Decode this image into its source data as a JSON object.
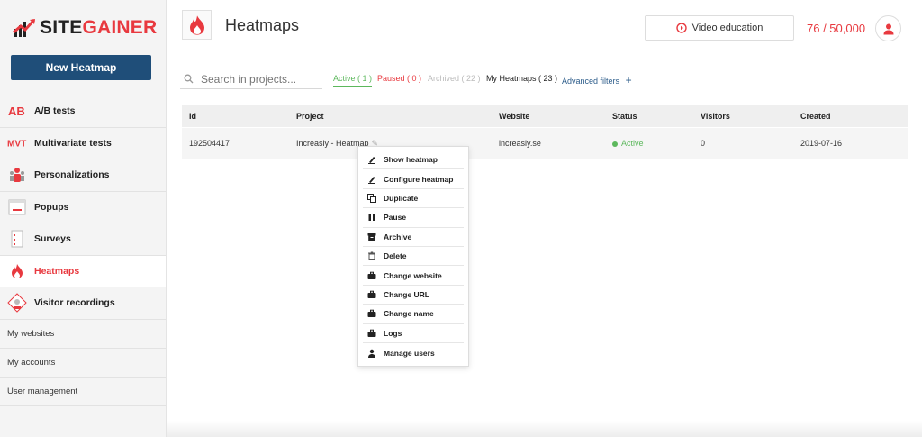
{
  "brand": {
    "part1": "SITE",
    "part2": "GAINER"
  },
  "sidebar": {
    "new_button": "New Heatmap",
    "items": [
      {
        "label": "A/B tests",
        "icon": "ab-icon"
      },
      {
        "label": "Multivariate tests",
        "icon": "mvt-icon"
      },
      {
        "label": "Personalizations",
        "icon": "people-icon"
      },
      {
        "label": "Popups",
        "icon": "popup-icon"
      },
      {
        "label": "Surveys",
        "icon": "survey-icon"
      },
      {
        "label": "Heatmaps",
        "icon": "flame-icon",
        "active": true
      },
      {
        "label": "Visitor recordings",
        "icon": "recording-icon"
      }
    ],
    "links": [
      "My websites",
      "My accounts",
      "User management"
    ]
  },
  "header": {
    "title": "Heatmaps",
    "video_button": "Video education",
    "credits": "76 / 50,000"
  },
  "filters": {
    "search_placeholder": "Search in projects...",
    "active": "Active ( 1 )",
    "paused": "Paused ( 0 )",
    "archived": "Archived ( 22 )",
    "mine": "My Heatmaps ( 23 )",
    "advanced": "Advanced filters"
  },
  "table": {
    "headers": [
      "Id",
      "Project",
      "Website",
      "Status",
      "Visitors",
      "Created"
    ],
    "row": {
      "id": "192504417",
      "project": "Increasly - Heatmap",
      "website": "increasly.se",
      "status": "Active",
      "visitors": "0",
      "created": "2019-07-16"
    }
  },
  "menu": [
    "Show heatmap",
    "Configure heatmap",
    "Duplicate",
    "Pause",
    "Archive",
    "Delete",
    "Change website",
    "Change URL",
    "Change name",
    "Logs",
    "Manage users"
  ],
  "colors": {
    "brand_red": "#e8393f",
    "brand_blue": "#1f4e79",
    "active_green": "#5cb85c"
  }
}
